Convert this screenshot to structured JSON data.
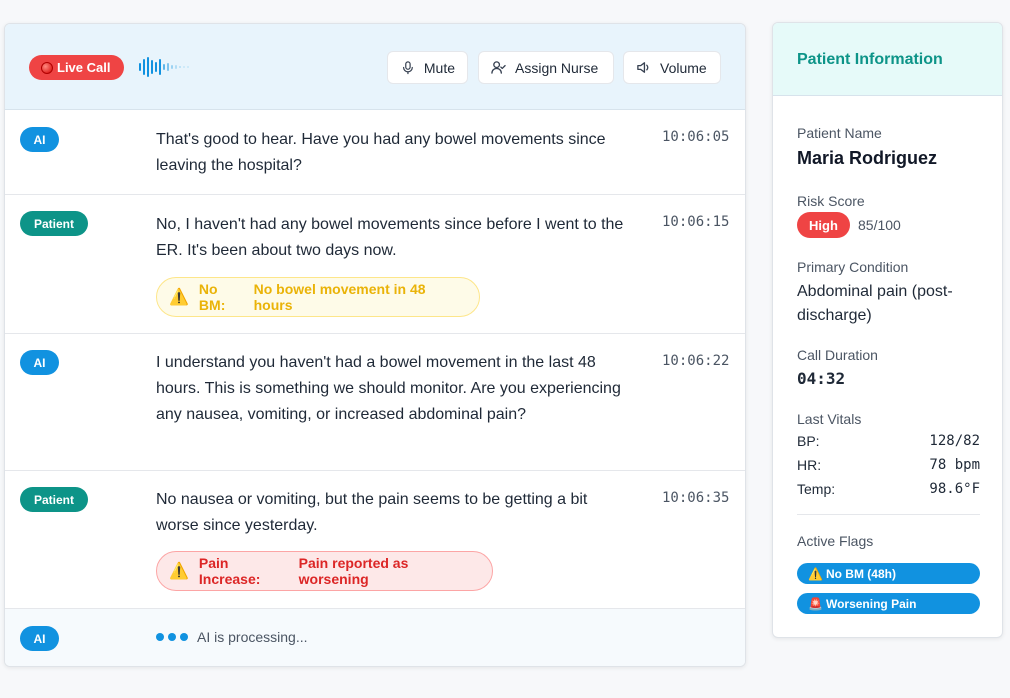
{
  "header": {
    "live_label": "Live Call",
    "buttons": {
      "mute": "Mute",
      "assign": "Assign Nurse",
      "volume": "Volume"
    }
  },
  "messages": [
    {
      "role": "AI",
      "text": "That's good to hear. Have you had any bowel movements since leaving the hospital?",
      "time": "10:06:05"
    },
    {
      "role": "Patient",
      "text": "No, I haven't had any bowel movements since before I went to the ER. It's been about two days now.",
      "time": "10:06:15",
      "flag": {
        "icon": "⚠️",
        "label": "No BM:",
        "detail": "No bowel movement in 48 hours"
      }
    },
    {
      "role": "AI",
      "text": "I understand you haven't had a bowel movement in the last 48 hours. This is something we should monitor. Are you experiencing any nausea, vomiting, or increased abdominal pain?",
      "time": "10:06:22"
    },
    {
      "role": "Patient",
      "text": "No nausea or vomiting, but the pain seems to be getting a bit worse since yesterday.",
      "time": "10:06:35",
      "flag": {
        "icon": "⚠️",
        "label": "Pain Increase:",
        "detail": "Pain reported as worsening"
      }
    }
  ],
  "processing": {
    "role": "AI",
    "text": "AI is processing..."
  },
  "patient_info": {
    "title": "Patient Information",
    "name_label": "Patient Name",
    "name": "Maria Rodriguez",
    "risk_label": "Risk Score",
    "risk_level": "High",
    "risk_score": "85/100",
    "condition_label": "Primary Condition",
    "condition": "Abdominal pain (post-discharge)",
    "duration_label": "Call Duration",
    "duration": "04:32",
    "vitals_label": "Last Vitals",
    "vitals": [
      {
        "label": "BP:",
        "value": "128/82"
      },
      {
        "label": "HR:",
        "value": "78 bpm"
      },
      {
        "label": "Temp:",
        "value": "98.6°F"
      }
    ],
    "flags_label": "Active Flags",
    "flags": [
      {
        "icon": "⚠️",
        "label": "No BM (48h)"
      },
      {
        "icon": "🚨",
        "label": "Worsening Pain"
      }
    ]
  },
  "colors": {
    "primary_blue": "#1192e0",
    "teal": "#0d9488",
    "danger_red": "#ef4444",
    "warning_yellow": "#eab308"
  }
}
